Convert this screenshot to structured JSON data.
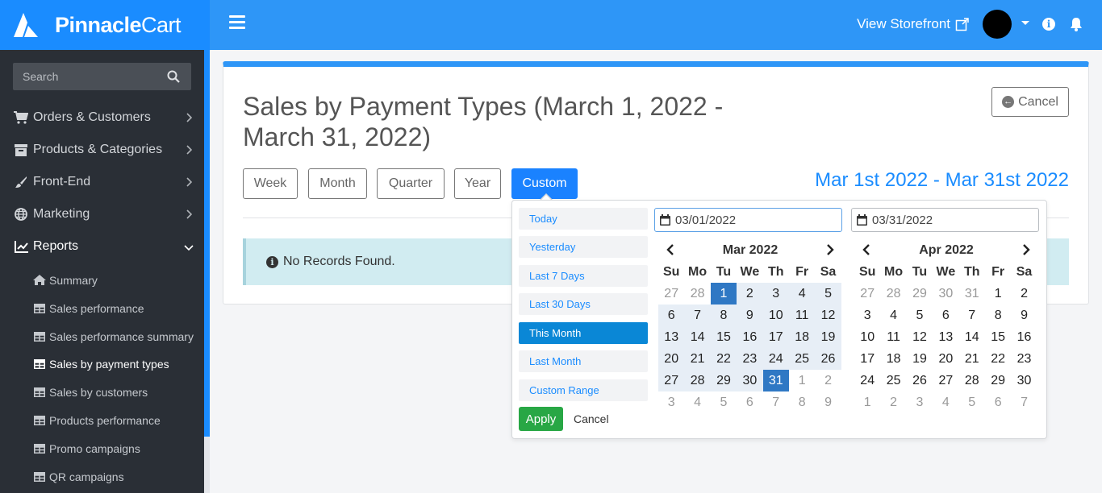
{
  "brand": {
    "name_bold": "Pinnacle",
    "name_light": "Cart"
  },
  "topbar": {
    "storefront_label": "View Storefront"
  },
  "sidebar": {
    "search_placeholder": "Search",
    "items": [
      {
        "label": "Orders & Customers",
        "icon": "cart-icon"
      },
      {
        "label": "Products & Categories",
        "icon": "archive-icon"
      },
      {
        "label": "Front-End",
        "icon": "brush-icon"
      },
      {
        "label": "Marketing",
        "icon": "globe-icon"
      },
      {
        "label": "Reports",
        "icon": "chart-icon"
      }
    ],
    "subitems": [
      {
        "label": "Summary",
        "icon": "home-icon"
      },
      {
        "label": "Sales performance",
        "icon": "table-icon"
      },
      {
        "label": "Sales performance summary",
        "icon": "table-icon"
      },
      {
        "label": "Sales by payment types",
        "icon": "table-icon"
      },
      {
        "label": "Sales by customers",
        "icon": "table-icon"
      },
      {
        "label": "Products performance",
        "icon": "table-icon"
      },
      {
        "label": "Promo campaigns",
        "icon": "table-icon"
      },
      {
        "label": "QR campaigns",
        "icon": "table-icon"
      }
    ]
  },
  "main": {
    "title": "Sales by Payment Types (March 1, 2022 - March 31, 2022)",
    "cancel_label": "Cancel",
    "periods": [
      "Week",
      "Month",
      "Quarter",
      "Year",
      "Custom"
    ],
    "active_period": "Custom",
    "range_text": "Mar 1st 2022 - Mar 31st 2022",
    "alert_text": "No Records Found."
  },
  "picker": {
    "ranges": [
      "Today",
      "Yesterday",
      "Last 7 Days",
      "Last 30 Days",
      "This Month",
      "Last Month",
      "Custom Range"
    ],
    "active_range": "This Month",
    "apply_label": "Apply",
    "cancel_label": "Cancel",
    "start_date": "03/01/2022",
    "end_date": "03/31/2022",
    "weekdays": [
      "Su",
      "Mo",
      "Tu",
      "We",
      "Th",
      "Fr",
      "Sa"
    ],
    "left_month": {
      "title": "Mar 2022",
      "days": [
        "27",
        "28",
        "1",
        "2",
        "3",
        "4",
        "5",
        "6",
        "7",
        "8",
        "9",
        "10",
        "11",
        "12",
        "13",
        "14",
        "15",
        "16",
        "17",
        "18",
        "19",
        "20",
        "21",
        "22",
        "23",
        "24",
        "25",
        "26",
        "27",
        "28",
        "29",
        "30",
        "31",
        "1",
        "2",
        "3",
        "4",
        "5",
        "6",
        "7",
        "8",
        "9"
      ]
    },
    "right_month": {
      "title": "Apr 2022",
      "days": [
        "27",
        "28",
        "29",
        "30",
        "31",
        "1",
        "2",
        "3",
        "4",
        "5",
        "6",
        "7",
        "8",
        "9",
        "10",
        "11",
        "12",
        "13",
        "14",
        "15",
        "16",
        "17",
        "18",
        "19",
        "20",
        "21",
        "22",
        "23",
        "24",
        "25",
        "26",
        "27",
        "28",
        "29",
        "30",
        "1",
        "2",
        "3",
        "4",
        "5",
        "6",
        "7"
      ]
    }
  },
  "colors": {
    "brand_blue": "#1a8cff",
    "topbar_blue": "#2e96f7",
    "sidebar_bg": "#2a2f36",
    "selected_day": "#2f78c4",
    "apply_green": "#28a745"
  }
}
